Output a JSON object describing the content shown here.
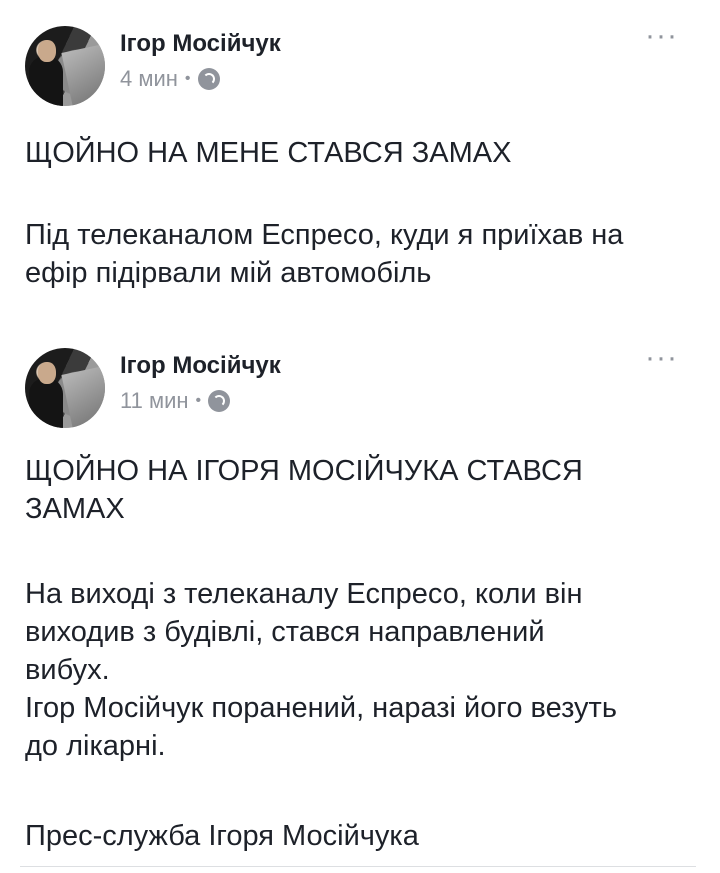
{
  "posts": [
    {
      "author": "Ігор Мосійчук",
      "time": "4 мин",
      "separator": "•",
      "privacy_icon": "globe-icon",
      "more_label": "···",
      "paragraphs": [
        "ЩОЙНО НА МЕНЕ СТАВСЯ ЗАМАХ",
        "Під телеканалом Еспресо, куди я приїхав на\nефір підірвали мій автомобіль"
      ]
    },
    {
      "author": "Ігор Мосійчук",
      "time": "11 мин",
      "separator": "•",
      "privacy_icon": "globe-icon",
      "more_label": "···",
      "paragraphs": [
        "ЩОЙНО НА ІГОРЯ МОСІЙЧУКА СТАВСЯ\nЗАМАХ",
        "На виході з телеканалу Еспресо, коли він\nвиходив з будівлі, стався направлений\nвибух.\nІгор Мосійчук поранений, наразі його везуть\nдо лікарні.",
        "Прес-служба Ігоря Мосійчука"
      ]
    }
  ],
  "colors": {
    "text": "#1d2129",
    "meta": "#90949c",
    "background": "#ffffff"
  }
}
